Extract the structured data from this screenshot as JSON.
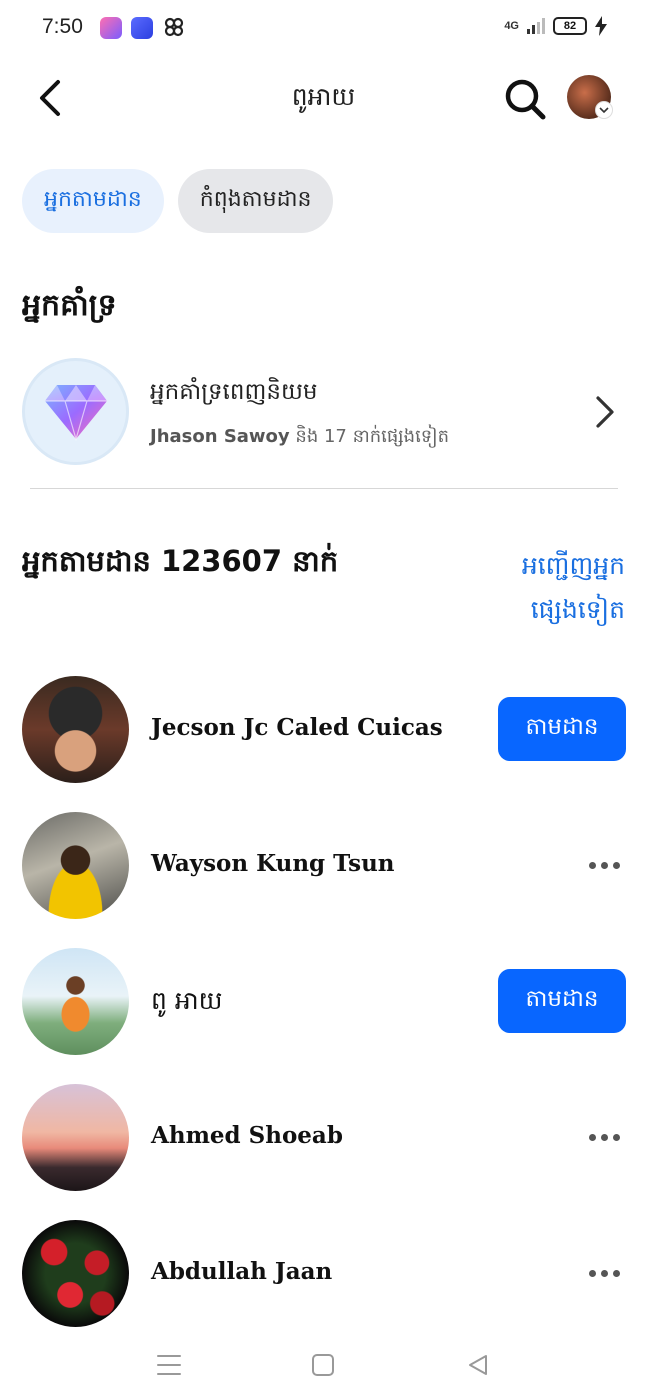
{
  "status_bar": {
    "time": "7:50",
    "network": "4G",
    "battery": "82"
  },
  "header": {
    "title": "ពូអាយ"
  },
  "tabs": [
    {
      "label": "អ្នកតាមដាន",
      "active": true
    },
    {
      "label": "កំពុងតាមដាន",
      "active": false
    }
  ],
  "supporters": {
    "section_title": "អ្នកគាំទ្រ",
    "title": "អ្នកគាំទ្រពេញនិយម",
    "sub_name": "Jhason Sawoy",
    "sub_rest": " និង 17 នាក់ផ្សេងទៀត"
  },
  "followers": {
    "title": "អ្នកតាមដាន 123607 នាក់",
    "see_more_line1": "អញ្ជើញអ្នក",
    "see_more_line2": "ផ្សេងទៀត",
    "items": [
      {
        "name": "Jecson Jc Caled Cuicas",
        "action": "តាមដាន"
      },
      {
        "name": "Wayson Kung Tsun",
        "action": "more"
      },
      {
        "name": "ពូ អាយ",
        "action": "តាមដាន"
      },
      {
        "name": "Ahmed Shoeab",
        "action": "more"
      },
      {
        "name": "Abdullah Jaan",
        "action": "more"
      }
    ]
  },
  "colors": {
    "accent": "#0866ff",
    "link": "#1a6fe0",
    "active_tab_bg": "#e8f1fd",
    "inactive_tab_bg": "#e6e7ea"
  },
  "icons": [
    "back-arrow-icon",
    "search-icon",
    "chevron-right-icon",
    "diamond-icon",
    "more-dots-icon",
    "menu-icon",
    "home-square-icon",
    "back-triangle-icon"
  ]
}
